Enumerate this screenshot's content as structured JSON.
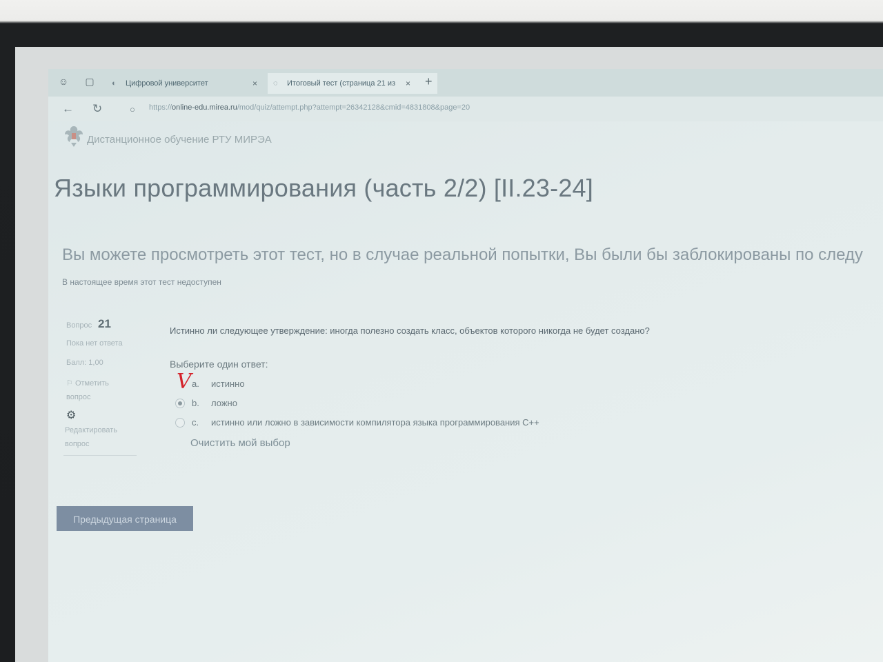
{
  "browser": {
    "tabs": [
      {
        "label": "Цифровой университет",
        "close": "×"
      },
      {
        "label": "Итоговый тест (страница 21 из",
        "close": "×"
      }
    ],
    "new_tab": "+",
    "url_prefix": "https://",
    "url_host": "online-edu.mirea.ru",
    "url_path": "/mod/quiz/attempt.php?attempt=26342128&cmid=4831808&page=20"
  },
  "site": {
    "name": "Дистанционное обучение РТУ МИРЭА"
  },
  "course": {
    "title": "Языки программирования (часть 2/2) [II.23-24]"
  },
  "notice": {
    "main": "Вы можете просмотреть этот тест, но в случае реальной попытки, Вы были бы заблокированы по следу",
    "sub": "В настоящее время этот тест недоступен"
  },
  "question": {
    "number_label": "Вопрос",
    "number": "21",
    "state": "Пока нет ответа",
    "mark": "Балл: 1,00",
    "flag_label": "Отметить вопрос",
    "edit_label": "Редактировать вопрос",
    "text": "Истинно ли следующее утверждение: иногда полезно создать класс, объектов которого никогда не будет создано?",
    "prompt": "Выберите один ответ:",
    "options": [
      {
        "letter": "a.",
        "text": "истинно"
      },
      {
        "letter": "b.",
        "text": "ложно"
      },
      {
        "letter": "c.",
        "text": "истинно или ложно в зависимости компилятора языка программирования С++"
      }
    ],
    "selected_option": "b.",
    "clear_label": "Очистить мой выбор"
  },
  "navigation": {
    "prev_label": "Предыдущая страница"
  },
  "colors": {
    "check_mark": "#d4222a",
    "button": "#7d8ea2"
  },
  "icons": {
    "back": "arrow-left-icon",
    "reload": "reload-icon",
    "flag": "flag-icon",
    "edit": "gear-icon",
    "logo": "eagle-emblem"
  }
}
